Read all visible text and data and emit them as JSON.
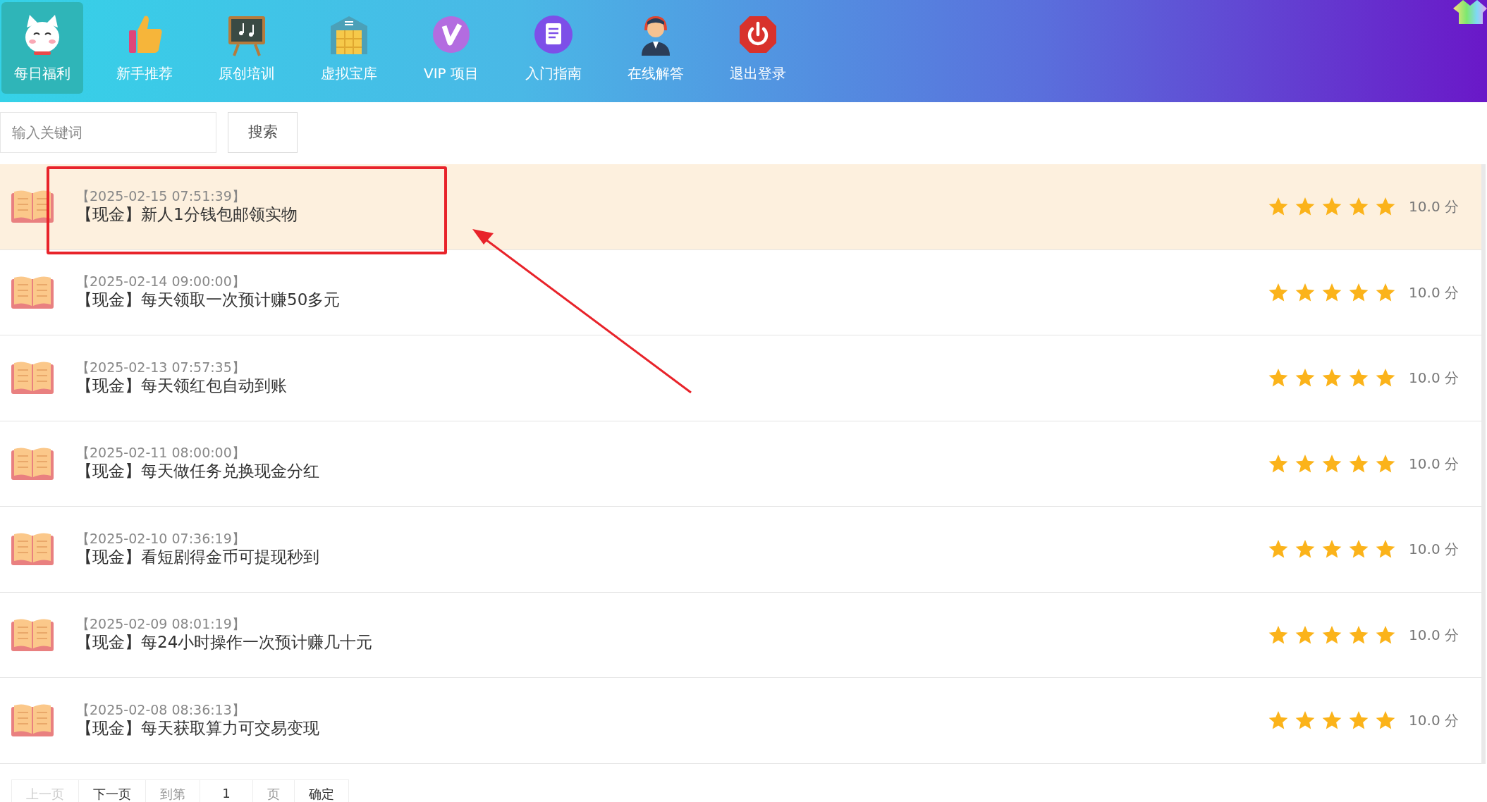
{
  "nav": [
    {
      "label": "每日福利",
      "selected": true
    },
    {
      "label": "新手推荐",
      "selected": false
    },
    {
      "label": "原创培训",
      "selected": false
    },
    {
      "label": "虚拟宝库",
      "selected": false
    },
    {
      "label": "VIP 项目",
      "selected": false
    },
    {
      "label": "入门指南",
      "selected": false
    },
    {
      "label": "在线解答",
      "selected": false
    },
    {
      "label": "退出登录",
      "selected": false
    }
  ],
  "search": {
    "placeholder": "输入关键词",
    "button": "搜索"
  },
  "items": [
    {
      "date": "【2025-02-15 07:51:39】",
      "title": "【现金】新人1分钱包邮领实物",
      "stars": 5,
      "score": "10.0 分",
      "selected": true
    },
    {
      "date": "【2025-02-14 09:00:00】",
      "title": "【现金】每天领取一次预计赚50多元",
      "stars": 5,
      "score": "10.0 分",
      "selected": false
    },
    {
      "date": "【2025-02-13 07:57:35】",
      "title": "【现金】每天领红包自动到账",
      "stars": 5,
      "score": "10.0 分",
      "selected": false
    },
    {
      "date": "【2025-02-11 08:00:00】",
      "title": "【现金】每天做任务兑换现金分红",
      "stars": 5,
      "score": "10.0 分",
      "selected": false
    },
    {
      "date": "【2025-02-10 07:36:19】",
      "title": "【现金】看短剧得金币可提现秒到",
      "stars": 5,
      "score": "10.0 分",
      "selected": false
    },
    {
      "date": "【2025-02-09 08:01:19】",
      "title": "【现金】每24小时操作一次预计赚几十元",
      "stars": 5,
      "score": "10.0 分",
      "selected": false
    },
    {
      "date": "【2025-02-08 08:36:13】",
      "title": "【现金】每天获取算力可交易变现",
      "stars": 5,
      "score": "10.0 分",
      "selected": false
    }
  ],
  "pagination": {
    "prev": {
      "label": "上一页",
      "disabled": true
    },
    "next": {
      "label": "下一页",
      "disabled": false
    },
    "goto_label": "到第",
    "page": "1",
    "page_unit": "页",
    "confirm": "确定"
  }
}
